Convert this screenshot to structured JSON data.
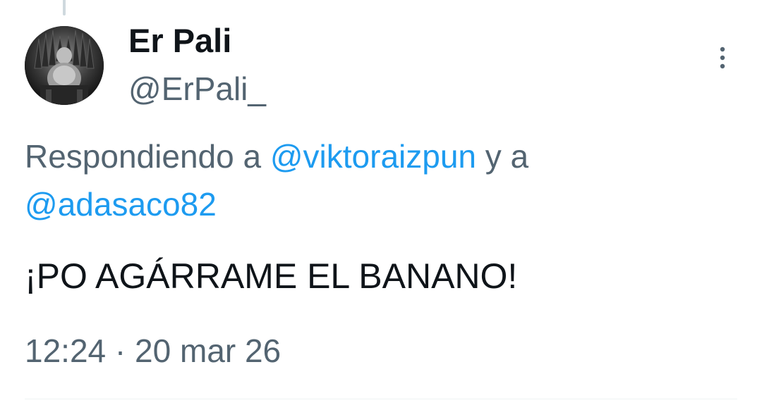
{
  "tweet": {
    "author": {
      "display_name": "Er Pali",
      "handle": "@ErPali_",
      "avatar_icon": "avatar-icon"
    },
    "more_icon": "more-vertical-icon",
    "reply_context": {
      "prefix": "Respondiendo a ",
      "mention_1": "@viktoraizpun",
      "connector": " y a",
      "mention_2": "@adasaco82"
    },
    "text": "¡PO AGÁRRAME EL BANANO!",
    "timestamp": "12:24 · 20 mar 26"
  },
  "colors": {
    "text_primary": "#0f1419",
    "text_secondary": "#536471",
    "link": "#1d9bf0",
    "thread_line": "#cfd9de"
  }
}
